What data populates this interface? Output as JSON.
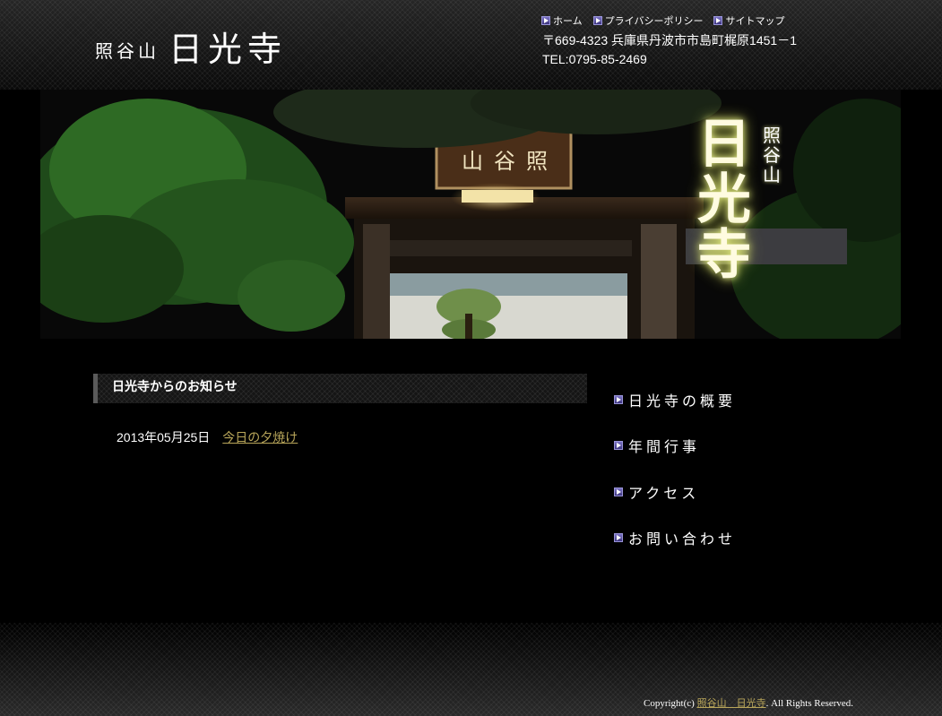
{
  "header": {
    "logo_small": "照谷山",
    "logo_big": "日光寺",
    "nav": [
      {
        "label": "ホーム"
      },
      {
        "label": "プライバシーポリシー"
      },
      {
        "label": "サイトマップ"
      }
    ],
    "address": "〒669-4323 兵庫県丹波市市島町梶原1451－1",
    "tel": "TEL:0795-85-2469"
  },
  "banner": {
    "title": "日\n光\n寺",
    "subtitle": "照\n谷\n山",
    "plaque": "山谷照"
  },
  "news": {
    "heading": "日光寺からのお知らせ",
    "items": [
      {
        "date": "2013年05月25日",
        "title": "今日の夕焼け"
      }
    ]
  },
  "sidebar": {
    "items": [
      {
        "label": "日光寺の概要"
      },
      {
        "label": "年間行事"
      },
      {
        "label": "アクセス"
      },
      {
        "label": "お問い合わせ"
      }
    ]
  },
  "footer": {
    "prefix": "Copyright(c) ",
    "link": "照谷山　日光寺",
    "suffix": ". All Rights Reserved."
  },
  "colors": {
    "link_gold": "#b9a65a",
    "bullet_purple": "#5a52a8",
    "background": "#000000"
  },
  "icons": {
    "nav_bullet": "arrow-right-icon"
  }
}
